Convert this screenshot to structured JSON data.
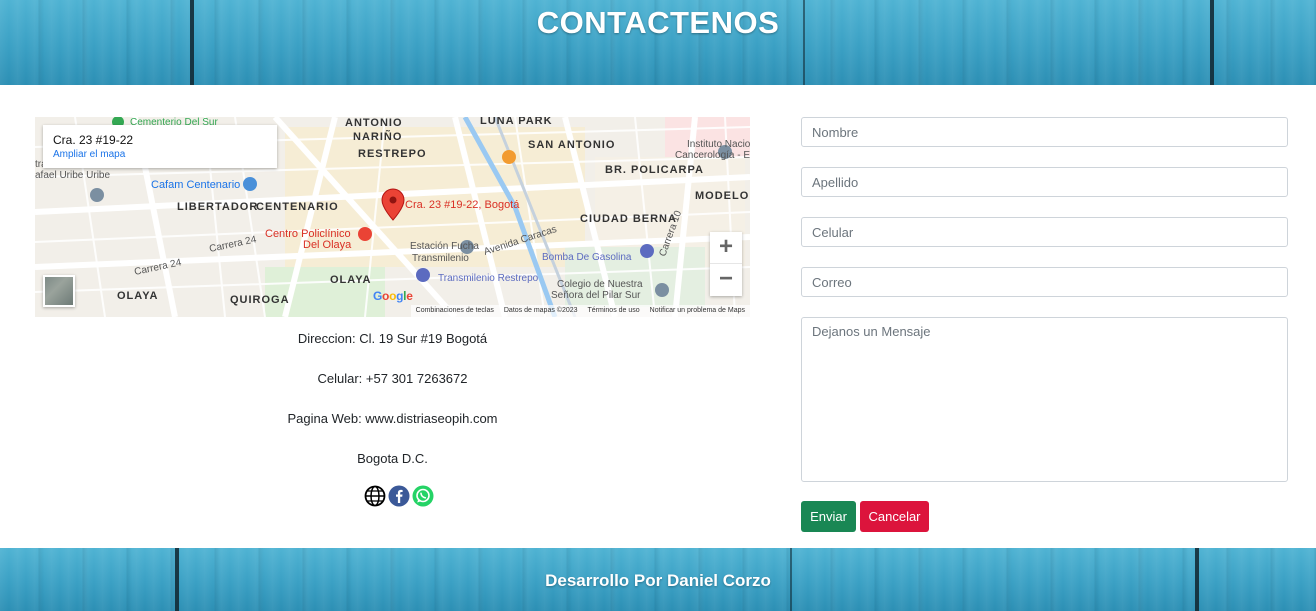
{
  "header": {
    "title": "CONTACTENOS"
  },
  "map": {
    "card_address": "Cra. 23 #19-22",
    "card_link": "Ampliar el mapa",
    "pin_label": "Cra. 23 #19-22, Bogotá",
    "zoom_in": "+",
    "zoom_out": "−",
    "google_letters": [
      "G",
      "o",
      "o",
      "g",
      "l",
      "e"
    ],
    "attribution": [
      "Combinaciones de teclas",
      "Datos de mapas ©2023",
      "Términos de uso",
      "Notificar un problema de Maps"
    ],
    "places": [
      "ANTONIO",
      "NARIÑO",
      "LUNA PARK",
      "RESTREPO",
      "SAN ANTONIO",
      "Instituto Nacional de",
      "Cancerología - ESE",
      "BR. POLICARPA",
      "Cafam Centenario",
      "LIBERTADOR",
      "CENTENARIO",
      "CIUDAD BERNA",
      "MODELO",
      "Centro Policlínico",
      "Del Olaya",
      "Estación Fucha",
      "Transmilenio",
      "Avenida Caracas",
      "Bomba De Gasolina",
      "Transmilenio Restrepo",
      "OLAYA",
      "QUIROGA",
      "Colegio de Nuestra",
      "Señora del Pilar Sur",
      "Carrera 24",
      "Carrera 10",
      "Cementerio Del Sur",
      "stradura Auxiliar",
      "afael Uribe Uribe"
    ]
  },
  "contact": {
    "address": "Direccion: Cl. 19 Sur #19 Bogotá",
    "phone": "Celular: +57 301 7263672",
    "website": "Pagina Web: www.distriaseopih.com",
    "city": "Bogota D.C."
  },
  "social_icons": [
    "globe-icon",
    "facebook-icon",
    "whatsapp-icon"
  ],
  "form": {
    "name_placeholder": "Nombre",
    "lastname_placeholder": "Apellido",
    "phone_placeholder": "Celular",
    "email_placeholder": "Correo",
    "message_placeholder": "Dejanos un Mensaje",
    "send_label": "Enviar",
    "cancel_label": "Cancelar"
  },
  "colors": {
    "send": "#198754",
    "cancel": "#dc143c",
    "pin": "#ea4335"
  },
  "footer": {
    "text": "Desarrollo Por Daniel Corzo"
  }
}
